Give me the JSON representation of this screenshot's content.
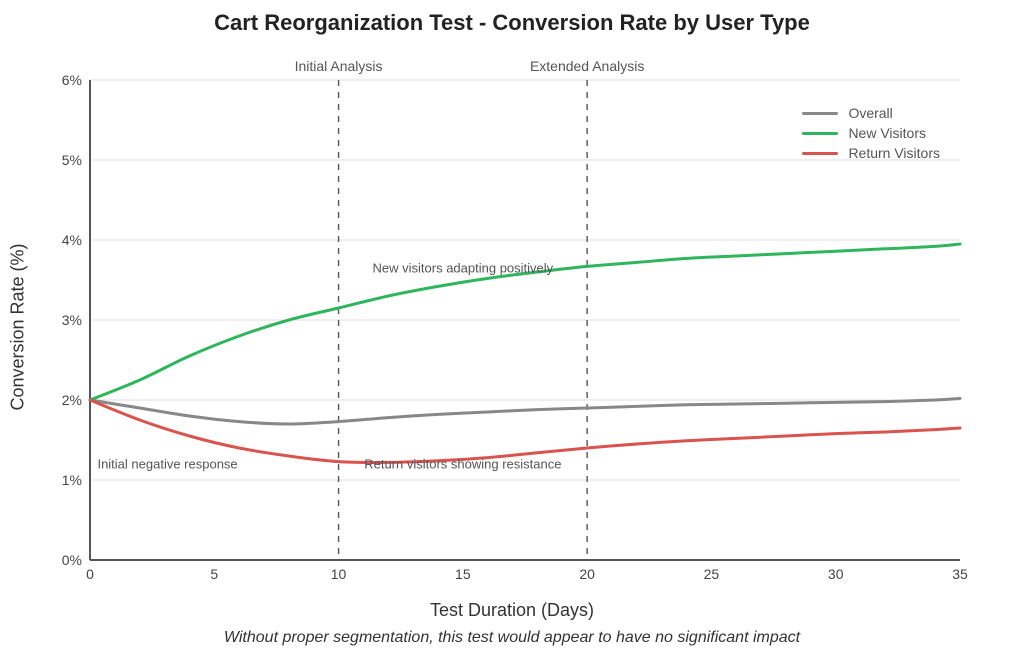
{
  "chart_data": {
    "type": "line",
    "title": "Cart Reorganization Test - Conversion Rate by User Type",
    "subtitle": "Without proper segmentation, this test would appear to have no significant impact",
    "xlabel": "Test Duration (Days)",
    "ylabel": "Conversion Rate (%)",
    "xlim": [
      0,
      35
    ],
    "ylim": [
      0,
      6
    ],
    "x_ticks": [
      0,
      5,
      10,
      15,
      20,
      25,
      30,
      35
    ],
    "y_ticks": [
      0,
      1,
      2,
      3,
      4,
      5,
      6
    ],
    "y_tick_labels": [
      "0%",
      "1%",
      "2%",
      "3%",
      "4%",
      "5%",
      "6%"
    ],
    "x": [
      0,
      2,
      4,
      6,
      8,
      10,
      12,
      14,
      16,
      18,
      20,
      22,
      24,
      26,
      28,
      30,
      32,
      34,
      35
    ],
    "series": [
      {
        "name": "Overall",
        "color": "#888888",
        "values": [
          2.0,
          1.9,
          1.8,
          1.73,
          1.7,
          1.73,
          1.78,
          1.82,
          1.85,
          1.88,
          1.9,
          1.92,
          1.94,
          1.95,
          1.96,
          1.97,
          1.98,
          2.0,
          2.02
        ]
      },
      {
        "name": "New Visitors",
        "color": "#2fb55b",
        "values": [
          2.0,
          2.25,
          2.55,
          2.8,
          3.0,
          3.15,
          3.3,
          3.42,
          3.52,
          3.6,
          3.67,
          3.72,
          3.77,
          3.8,
          3.83,
          3.86,
          3.89,
          3.92,
          3.95
        ]
      },
      {
        "name": "Return Visitors",
        "color": "#d9534f",
        "values": [
          2.0,
          1.75,
          1.55,
          1.4,
          1.3,
          1.23,
          1.22,
          1.24,
          1.28,
          1.34,
          1.4,
          1.45,
          1.49,
          1.52,
          1.55,
          1.58,
          1.6,
          1.63,
          1.65
        ]
      }
    ],
    "vlines": [
      {
        "x": 10,
        "label": "Initial Analysis"
      },
      {
        "x": 20,
        "label": "Extended Analysis"
      }
    ],
    "annotations": [
      {
        "text": "New visitors adapting positively",
        "x": 15,
        "y": 3.65,
        "anchor": "middle"
      },
      {
        "text": "Return visitors showing resistance",
        "x": 15,
        "y": 1.2,
        "anchor": "middle"
      },
      {
        "text": "Initial negative response",
        "x": 0.3,
        "y": 1.2,
        "anchor": "start"
      }
    ],
    "legend_position": "top-right"
  }
}
